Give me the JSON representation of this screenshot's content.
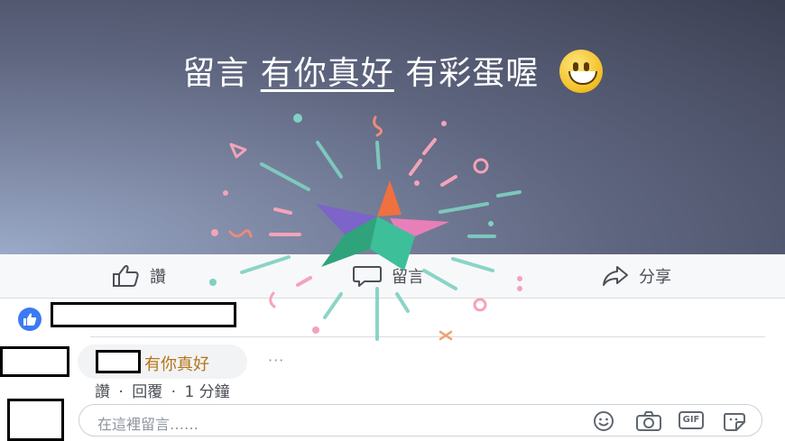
{
  "banner": {
    "title_part1": "留言",
    "title_part2": "有你真好",
    "title_part3": "有彩蛋喔"
  },
  "actions": {
    "like": "讚",
    "comment": "留言",
    "share": "分享"
  },
  "comment": {
    "text": "有你真好",
    "more": "···",
    "like": "讚",
    "reply": "回覆",
    "time": "1 分鐘",
    "separator": "·"
  },
  "input": {
    "placeholder": "在這裡留言……",
    "gif_label": "GIF"
  },
  "colors": {
    "like_blue": "#3b7af5",
    "comment_text": "#b5751a",
    "star_orange": "#f07040",
    "star_pink": "#e87fb8",
    "star_purple": "#7c64c8",
    "star_teal": "#3dbf9a",
    "star_green": "#2fa37a"
  }
}
